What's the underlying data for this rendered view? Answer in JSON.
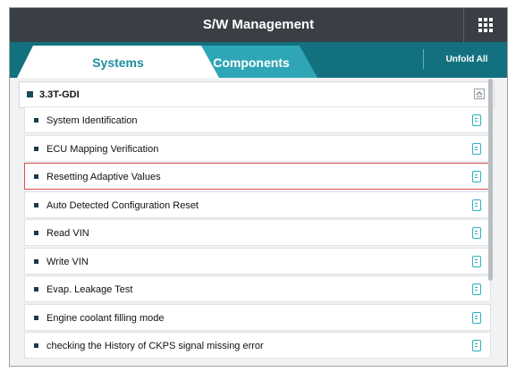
{
  "app": {
    "title": "S/W Management",
    "menu_icon": "grid-menu-icon"
  },
  "tabs": [
    {
      "label": "Systems",
      "active": true
    },
    {
      "label": "Components",
      "active": false
    }
  ],
  "unfold_all_label": "Unfold All",
  "group": {
    "title": "3.3T-GDI",
    "collapse_icon": "collapse-arrow-icon"
  },
  "items": [
    {
      "label": "System Identification",
      "icon": "document-icon",
      "selected": false
    },
    {
      "label": "ECU Mapping Verification",
      "icon": "document-icon",
      "selected": false
    },
    {
      "label": "Resetting Adaptive Values",
      "icon": "document-icon",
      "selected": true
    },
    {
      "label": "Auto Detected Configuration Reset",
      "icon": "document-icon",
      "selected": false
    },
    {
      "label": "Read VIN",
      "icon": "document-icon",
      "selected": false
    },
    {
      "label": "Write VIN",
      "icon": "document-icon",
      "selected": false
    },
    {
      "label": "Evap. Leakage Test",
      "icon": "document-icon",
      "selected": false
    },
    {
      "label": "Engine coolant filling mode",
      "icon": "document-icon",
      "selected": false
    },
    {
      "label": "checking the History of  CKPS signal missing error",
      "icon": "document-icon",
      "selected": false
    }
  ],
  "colors": {
    "header_bg": "#3a3f45",
    "tab_bar": "#13717f",
    "active_tab_text": "#1d8fa0",
    "inactive_tab": "#2fa6b5",
    "selection_border": "#d9534f",
    "doc_icon": "#2ab0c4"
  }
}
